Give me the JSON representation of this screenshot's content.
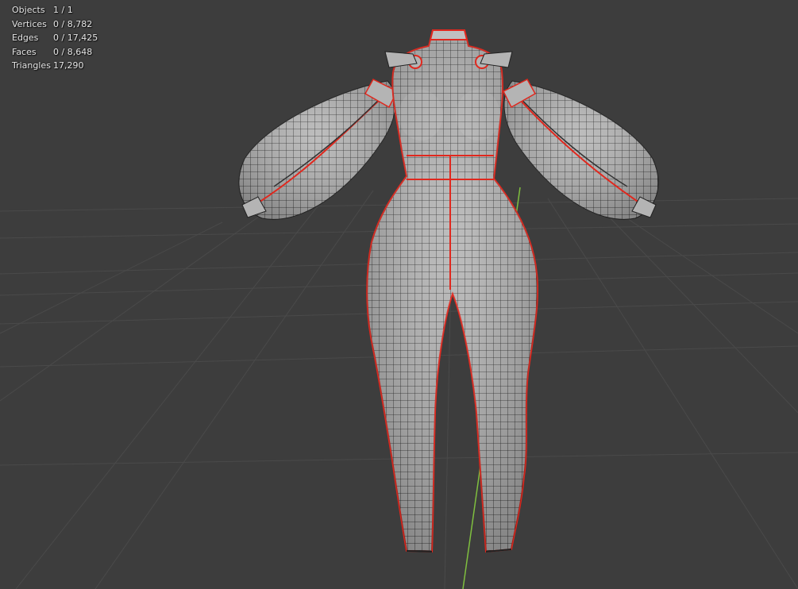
{
  "statistics": [
    {
      "label": "Objects",
      "value": "1 / 1"
    },
    {
      "label": "Vertices",
      "value": "0 / 8,782"
    },
    {
      "label": "Edges",
      "value": "0 / 17,425"
    },
    {
      "label": "Faces",
      "value": "0 / 8,648"
    },
    {
      "label": "Triangles",
      "value": "17,290"
    }
  ],
  "colors": {
    "background": "#3d3d3d",
    "grid": "#4a4a4a",
    "mesh_fill": "#b4b4b4",
    "mesh_wire": "#1c1c1c",
    "seam": "#e0281e",
    "y_axis": "#7fbf3f"
  }
}
